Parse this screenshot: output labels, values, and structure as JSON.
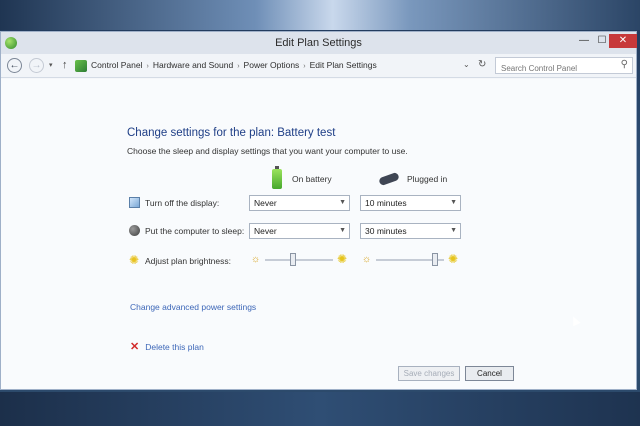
{
  "window": {
    "title": "Edit Plan Settings",
    "controls": {
      "minimize": "—",
      "maximize": "☐",
      "close": "✕"
    }
  },
  "nav": {
    "back_glyph": "←",
    "forward_glyph": "→",
    "history_glyph": "▾",
    "up_glyph": "↑",
    "breadcrumb": [
      "Control Panel",
      "Hardware and Sound",
      "Power Options",
      "Edit Plan Settings"
    ],
    "breadcrumb_sep": "›",
    "dropdown_glyph": "⌄",
    "refresh_glyph": "↻",
    "search_placeholder": "Search Control Panel",
    "search_glyph": "⚲"
  },
  "page": {
    "heading": "Change settings for the plan: Battery test",
    "subheading": "Choose the sleep and display settings that you want your computer to use.",
    "columns": {
      "battery": "On battery",
      "plugged": "Plugged in"
    },
    "rows": {
      "display": {
        "label": "Turn off the display:",
        "battery": "Never",
        "plugged": "10 minutes"
      },
      "sleep": {
        "label": "Put the computer to sleep:",
        "battery": "Never",
        "plugged": "30 minutes"
      },
      "brightness": {
        "label": "Adjust plan brightness:",
        "battery_level": 0.4,
        "plugged_level": 0.9
      }
    },
    "dropdown_glyph": "▼",
    "dim_sun_glyph": "☼",
    "bright_sun_glyph": "✺",
    "row_sun_glyph": "✺",
    "advanced_link": "Change advanced power settings",
    "delete_link": "Delete this plan",
    "delete_glyph": "✕",
    "save_button": "Save changes",
    "cancel_button": "Cancel"
  }
}
